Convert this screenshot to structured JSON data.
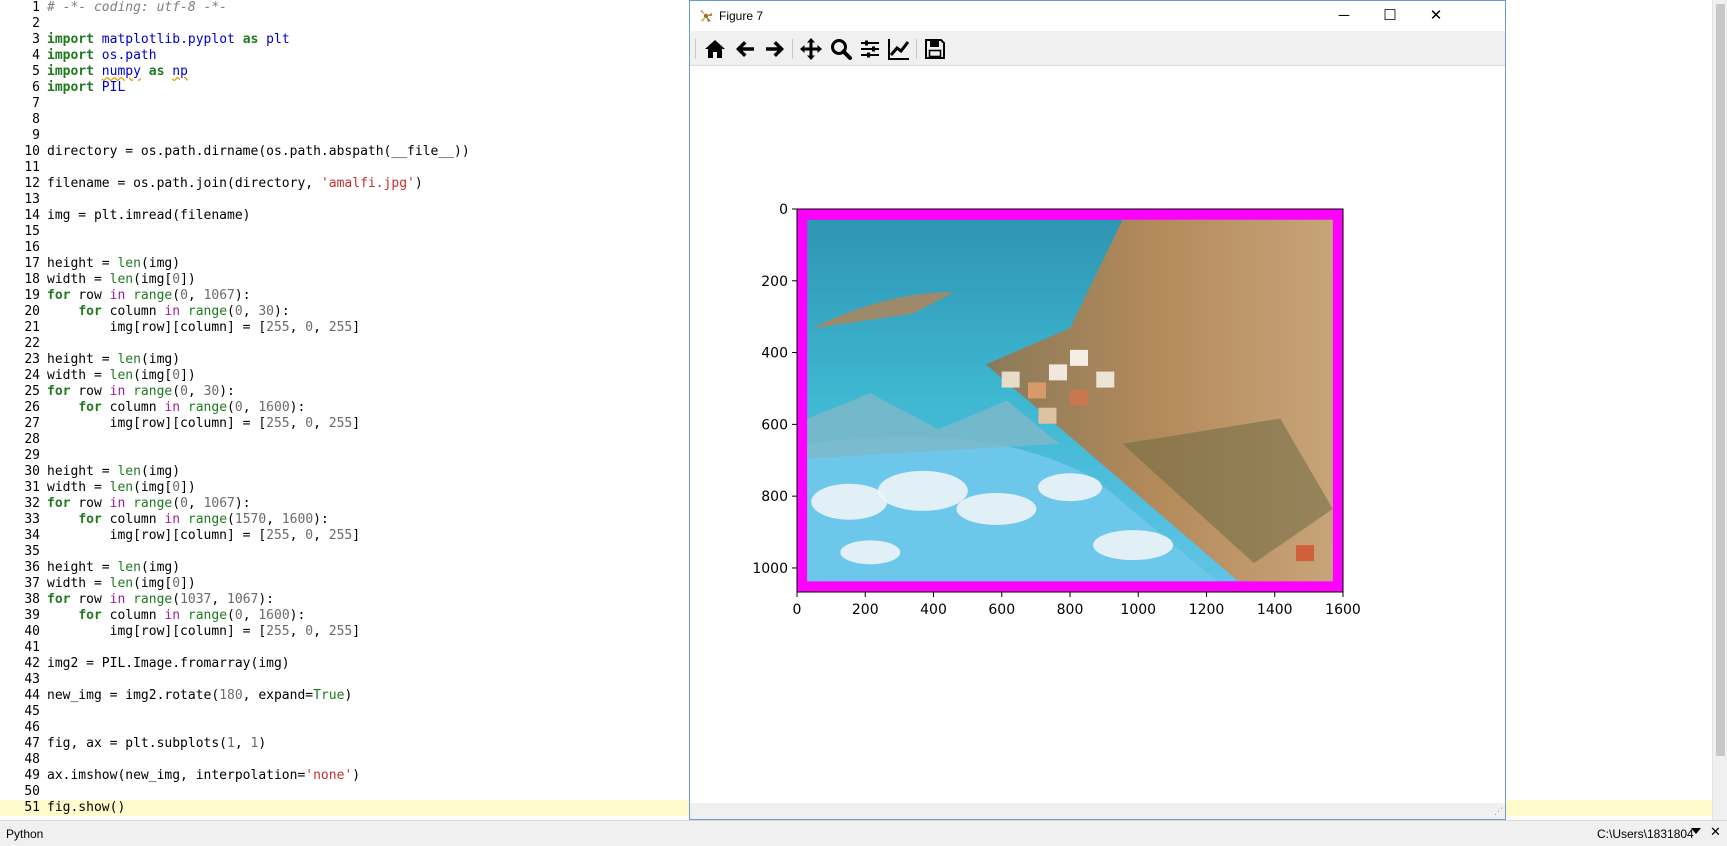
{
  "editor": {
    "lines": [
      {
        "n": "1",
        "tokens": [
          [
            "c",
            "# -*- coding: utf-8 -*-"
          ]
        ]
      },
      {
        "n": "2",
        "tokens": []
      },
      {
        "n": "3",
        "tokens": [
          [
            "k",
            "import"
          ],
          [
            "p",
            " "
          ],
          [
            "m",
            "matplotlib.pyplot"
          ],
          [
            "p",
            " "
          ],
          [
            "k",
            "as"
          ],
          [
            "p",
            " "
          ],
          [
            "m",
            "plt"
          ]
        ]
      },
      {
        "n": "4",
        "tokens": [
          [
            "k",
            "import"
          ],
          [
            "p",
            " "
          ],
          [
            "m",
            "os.path"
          ]
        ]
      },
      {
        "n": "5",
        "tokens": [
          [
            "k",
            "import"
          ],
          [
            "p",
            " "
          ],
          [
            "mu",
            "numpy"
          ],
          [
            "p",
            " "
          ],
          [
            "k",
            "as"
          ],
          [
            "p",
            " "
          ],
          [
            "mu",
            "np"
          ]
        ]
      },
      {
        "n": "6",
        "tokens": [
          [
            "k",
            "import"
          ],
          [
            "p",
            " "
          ],
          [
            "m",
            "PIL"
          ]
        ]
      },
      {
        "n": "7",
        "tokens": []
      },
      {
        "n": "8",
        "tokens": []
      },
      {
        "n": "9",
        "tokens": []
      },
      {
        "n": "10",
        "tokens": [
          [
            "p",
            "directory = os.path.dirname(os.path.abspath(__file__))"
          ]
        ]
      },
      {
        "n": "11",
        "tokens": []
      },
      {
        "n": "12",
        "tokens": [
          [
            "p",
            "filename = os.path.join(directory, "
          ],
          [
            "s",
            "'amalfi.jpg'"
          ],
          [
            "p",
            ")"
          ]
        ]
      },
      {
        "n": "13",
        "tokens": []
      },
      {
        "n": "14",
        "tokens": [
          [
            "p",
            "img = plt.imread(filename)"
          ]
        ]
      },
      {
        "n": "15",
        "tokens": []
      },
      {
        "n": "16",
        "tokens": []
      },
      {
        "n": "17",
        "tokens": [
          [
            "p",
            "height = "
          ],
          [
            "b",
            "len"
          ],
          [
            "p",
            "(img)"
          ]
        ]
      },
      {
        "n": "18",
        "tokens": [
          [
            "p",
            "width = "
          ],
          [
            "b",
            "len"
          ],
          [
            "p",
            "(img["
          ],
          [
            "n",
            "0"
          ],
          [
            "p",
            "])"
          ]
        ]
      },
      {
        "n": "19",
        "tokens": [
          [
            "k",
            "for"
          ],
          [
            "p",
            " row "
          ],
          [
            "k2",
            "in"
          ],
          [
            "p",
            " "
          ],
          [
            "b",
            "range"
          ],
          [
            "p",
            "("
          ],
          [
            "n",
            "0"
          ],
          [
            "p",
            ", "
          ],
          [
            "n",
            "1067"
          ],
          [
            "p",
            "):"
          ]
        ]
      },
      {
        "n": "20",
        "tokens": [
          [
            "p",
            "    "
          ],
          [
            "k",
            "for"
          ],
          [
            "p",
            " column "
          ],
          [
            "k2",
            "in"
          ],
          [
            "p",
            " "
          ],
          [
            "b",
            "range"
          ],
          [
            "p",
            "("
          ],
          [
            "n",
            "0"
          ],
          [
            "p",
            ", "
          ],
          [
            "n",
            "30"
          ],
          [
            "p",
            "):"
          ]
        ]
      },
      {
        "n": "21",
        "tokens": [
          [
            "p",
            "        img[row][column] = ["
          ],
          [
            "n",
            "255"
          ],
          [
            "p",
            ", "
          ],
          [
            "n",
            "0"
          ],
          [
            "p",
            ", "
          ],
          [
            "n",
            "255"
          ],
          [
            "p",
            "]"
          ]
        ]
      },
      {
        "n": "22",
        "tokens": []
      },
      {
        "n": "23",
        "tokens": [
          [
            "p",
            "height = "
          ],
          [
            "b",
            "len"
          ],
          [
            "p",
            "(img)"
          ]
        ]
      },
      {
        "n": "24",
        "tokens": [
          [
            "p",
            "width = "
          ],
          [
            "b",
            "len"
          ],
          [
            "p",
            "(img["
          ],
          [
            "n",
            "0"
          ],
          [
            "p",
            "])"
          ]
        ]
      },
      {
        "n": "25",
        "tokens": [
          [
            "k",
            "for"
          ],
          [
            "p",
            " row "
          ],
          [
            "k2",
            "in"
          ],
          [
            "p",
            " "
          ],
          [
            "b",
            "range"
          ],
          [
            "p",
            "("
          ],
          [
            "n",
            "0"
          ],
          [
            "p",
            ", "
          ],
          [
            "n",
            "30"
          ],
          [
            "p",
            "):"
          ]
        ]
      },
      {
        "n": "26",
        "tokens": [
          [
            "p",
            "    "
          ],
          [
            "k",
            "for"
          ],
          [
            "p",
            " column "
          ],
          [
            "k2",
            "in"
          ],
          [
            "p",
            " "
          ],
          [
            "b",
            "range"
          ],
          [
            "p",
            "("
          ],
          [
            "n",
            "0"
          ],
          [
            "p",
            ", "
          ],
          [
            "n",
            "1600"
          ],
          [
            "p",
            "):"
          ]
        ]
      },
      {
        "n": "27",
        "tokens": [
          [
            "p",
            "        img[row][column] = ["
          ],
          [
            "n",
            "255"
          ],
          [
            "p",
            ", "
          ],
          [
            "n",
            "0"
          ],
          [
            "p",
            ", "
          ],
          [
            "n",
            "255"
          ],
          [
            "p",
            "]"
          ]
        ]
      },
      {
        "n": "28",
        "tokens": []
      },
      {
        "n": "29",
        "tokens": []
      },
      {
        "n": "30",
        "tokens": [
          [
            "p",
            "height = "
          ],
          [
            "b",
            "len"
          ],
          [
            "p",
            "(img)"
          ]
        ]
      },
      {
        "n": "31",
        "tokens": [
          [
            "p",
            "width = "
          ],
          [
            "b",
            "len"
          ],
          [
            "p",
            "(img["
          ],
          [
            "n",
            "0"
          ],
          [
            "p",
            "])"
          ]
        ]
      },
      {
        "n": "32",
        "tokens": [
          [
            "k",
            "for"
          ],
          [
            "p",
            " row "
          ],
          [
            "k2",
            "in"
          ],
          [
            "p",
            " "
          ],
          [
            "b",
            "range"
          ],
          [
            "p",
            "("
          ],
          [
            "n",
            "0"
          ],
          [
            "p",
            ", "
          ],
          [
            "n",
            "1067"
          ],
          [
            "p",
            "):"
          ]
        ]
      },
      {
        "n": "33",
        "tokens": [
          [
            "p",
            "    "
          ],
          [
            "k",
            "for"
          ],
          [
            "p",
            " column "
          ],
          [
            "k2",
            "in"
          ],
          [
            "p",
            " "
          ],
          [
            "b",
            "range"
          ],
          [
            "p",
            "("
          ],
          [
            "n",
            "1570"
          ],
          [
            "p",
            ", "
          ],
          [
            "n",
            "1600"
          ],
          [
            "p",
            "):"
          ]
        ]
      },
      {
        "n": "34",
        "tokens": [
          [
            "p",
            "        img[row][column] = ["
          ],
          [
            "n",
            "255"
          ],
          [
            "p",
            ", "
          ],
          [
            "n",
            "0"
          ],
          [
            "p",
            ", "
          ],
          [
            "n",
            "255"
          ],
          [
            "p",
            "]"
          ]
        ]
      },
      {
        "n": "35",
        "tokens": []
      },
      {
        "n": "36",
        "tokens": [
          [
            "p",
            "height = "
          ],
          [
            "b",
            "len"
          ],
          [
            "p",
            "(img)"
          ]
        ]
      },
      {
        "n": "37",
        "tokens": [
          [
            "p",
            "width = "
          ],
          [
            "b",
            "len"
          ],
          [
            "p",
            "(img["
          ],
          [
            "n",
            "0"
          ],
          [
            "p",
            "])"
          ]
        ]
      },
      {
        "n": "38",
        "tokens": [
          [
            "k",
            "for"
          ],
          [
            "p",
            " row "
          ],
          [
            "k2",
            "in"
          ],
          [
            "p",
            " "
          ],
          [
            "b",
            "range"
          ],
          [
            "p",
            "("
          ],
          [
            "n",
            "1037"
          ],
          [
            "p",
            ", "
          ],
          [
            "n",
            "1067"
          ],
          [
            "p",
            "):"
          ]
        ]
      },
      {
        "n": "39",
        "tokens": [
          [
            "p",
            "    "
          ],
          [
            "k",
            "for"
          ],
          [
            "p",
            " column "
          ],
          [
            "k2",
            "in"
          ],
          [
            "p",
            " "
          ],
          [
            "b",
            "range"
          ],
          [
            "p",
            "("
          ],
          [
            "n",
            "0"
          ],
          [
            "p",
            ", "
          ],
          [
            "n",
            "1600"
          ],
          [
            "p",
            "):"
          ]
        ]
      },
      {
        "n": "40",
        "tokens": [
          [
            "p",
            "        img[row][column] = ["
          ],
          [
            "n",
            "255"
          ],
          [
            "p",
            ", "
          ],
          [
            "n",
            "0"
          ],
          [
            "p",
            ", "
          ],
          [
            "n",
            "255"
          ],
          [
            "p",
            "]"
          ]
        ]
      },
      {
        "n": "41",
        "tokens": []
      },
      {
        "n": "42",
        "tokens": [
          [
            "p",
            "img2 = PIL.Image.fromarray(img)"
          ]
        ]
      },
      {
        "n": "43",
        "tokens": []
      },
      {
        "n": "44",
        "tokens": [
          [
            "p",
            "new_img = img2.rotate("
          ],
          [
            "n",
            "180"
          ],
          [
            "p",
            ", expand="
          ],
          [
            "b",
            "True"
          ],
          [
            "p",
            ")"
          ]
        ]
      },
      {
        "n": "45",
        "tokens": []
      },
      {
        "n": "46",
        "tokens": []
      },
      {
        "n": "47",
        "tokens": [
          [
            "p",
            "fig, ax = plt.subplots("
          ],
          [
            "n",
            "1"
          ],
          [
            "p",
            ", "
          ],
          [
            "n",
            "1"
          ],
          [
            "p",
            ")"
          ]
        ]
      },
      {
        "n": "48",
        "tokens": []
      },
      {
        "n": "49",
        "tokens": [
          [
            "p",
            "ax.imshow(new_img, interpolation="
          ],
          [
            "s",
            "'none'"
          ],
          [
            "p",
            ")"
          ]
        ]
      },
      {
        "n": "50",
        "tokens": []
      },
      {
        "n": "51",
        "tokens": [
          [
            "p",
            "fig.show()"
          ]
        ]
      }
    ],
    "current_line": "51"
  },
  "statusbar": {
    "language": "Python",
    "path": "C:\\Users\\1831804",
    "dropdown_icon": "chevron-down-icon",
    "close_icon": "close-icon"
  },
  "figure_window": {
    "title": "Figure 7",
    "buttons": {
      "minimize": "─",
      "maximize": "☐",
      "close": "✕"
    },
    "toolbar": [
      {
        "name": "home-icon"
      },
      {
        "name": "back-arrow-icon"
      },
      {
        "name": "forward-arrow-icon"
      },
      {
        "name": "pan-move-icon"
      },
      {
        "name": "zoom-magnifier-icon"
      },
      {
        "name": "subplots-config-icon"
      },
      {
        "name": "edit-axis-icon"
      },
      {
        "name": "save-floppy-icon"
      }
    ]
  },
  "colors": {
    "border_magenta": "#ff00ff",
    "sea": "#2fa9c6",
    "sky": "#6cc7ea",
    "cliff": "#b49065"
  },
  "chart_data": {
    "type": "image",
    "xlim": [
      0,
      1600
    ],
    "ylim": [
      1067,
      0
    ],
    "xticks": [
      "0",
      "200",
      "400",
      "600",
      "800",
      "1000",
      "1200",
      "1400",
      "1600"
    ],
    "yticks": [
      "0",
      "200",
      "400",
      "600",
      "800",
      "1000"
    ],
    "xtick_values": [
      0,
      200,
      400,
      600,
      800,
      1000,
      1200,
      1400,
      1600
    ],
    "ytick_values": [
      0,
      200,
      400,
      600,
      800,
      1000
    ],
    "border_width": 30
  }
}
